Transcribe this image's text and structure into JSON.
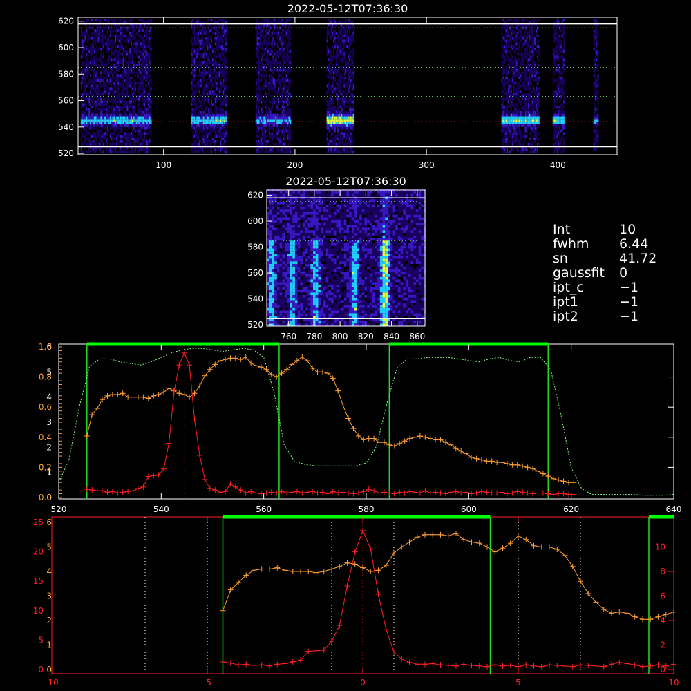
{
  "colors": {
    "background": "#000000",
    "axis_white": "#ffffff",
    "axis_red": "#ff2020",
    "orange": "#ffa030",
    "red_curve": "#ff2020",
    "green_bar": "#00ff00",
    "green_line": "#20e020",
    "green_dotted": "#80ff80",
    "image_low": "#1a0060",
    "image_mid": "#3a18c8",
    "image_high": "#20d0ff",
    "image_peak": "#e0ff40"
  },
  "info_panel": {
    "rows": [
      {
        "key": "Int",
        "value": "10"
      },
      {
        "key": "fwhm",
        "value": "6.44"
      },
      {
        "key": "sn",
        "value": "41.72"
      },
      {
        "key": "gaussfit",
        "value": "0"
      },
      {
        "key": "ipt_c",
        "value": "−1"
      },
      {
        "key": "ipt1",
        "value": "−1"
      },
      {
        "key": "ipt2",
        "value": "−1"
      }
    ]
  },
  "chart_data": [
    {
      "type": "heatmap",
      "title": "2022-05-12T07:36:30",
      "xlim": [
        35,
        445
      ],
      "ylim": [
        519,
        623
      ],
      "xticks": [
        100,
        200,
        300,
        400
      ],
      "yticks": [
        520,
        540,
        560,
        580,
        600,
        620
      ],
      "hlines_white": [
        525,
        618
      ],
      "hlines_green_dotted": [
        563,
        585,
        615
      ],
      "hline_red_dotted": 544,
      "bands": [
        {
          "x0": 37,
          "x1": 90,
          "strength": 0.55
        },
        {
          "x0": 121,
          "x1": 147,
          "strength": 0.6
        },
        {
          "x0": 170,
          "x1": 196,
          "strength": 0.45
        },
        {
          "x0": 224,
          "x1": 244,
          "strength": 1.0
        },
        {
          "x0": 357,
          "x1": 385,
          "strength": 0.75
        },
        {
          "x0": 396,
          "x1": 404,
          "strength": 0.7
        },
        {
          "x0": 427,
          "x1": 430,
          "strength": 0.5
        }
      ],
      "line_center": 544
    },
    {
      "type": "heatmap",
      "title": "2022-05-12T07:36:30",
      "xlim": [
        743,
        866
      ],
      "ylim": [
        519,
        624
      ],
      "xticks": [
        760,
        780,
        800,
        820,
        840,
        860
      ],
      "yticks": [
        520,
        540,
        560,
        580,
        600,
        620
      ],
      "hlines_white": [
        525,
        618
      ],
      "hlines_green_dotted": [
        563,
        585,
        615
      ],
      "columns_bright": [
        746,
        762,
        780,
        810,
        834
      ],
      "peak_column": 834
    },
    {
      "type": "line",
      "xlim": [
        520,
        640
      ],
      "xticks": [
        520,
        540,
        560,
        580,
        600,
        620,
        640
      ],
      "left_axis_white": {
        "ylim": [
          0,
          6
        ],
        "ticks": [
          "0",
          "1",
          "2",
          "3",
          "4",
          "5",
          "6"
        ]
      },
      "left_axis_orange": {
        "ylim": [
          0,
          1.0
        ],
        "ticks": [
          "0.0",
          "0.2",
          "0.4",
          "0.6",
          "0.8",
          "1.0"
        ]
      },
      "green_ranges": [
        [
          525.5,
          563
        ],
        [
          584.5,
          615.5
        ]
      ],
      "red_peak_x": 544.5,
      "series": [
        {
          "color": "orange",
          "x": [
            525.5,
            526.5,
            527.5,
            528.5,
            529.5,
            530.5,
            531.5,
            532.5,
            533.5,
            534.5,
            535.5,
            536.5,
            537.5,
            538.5,
            539.5,
            540.5,
            541.5,
            542.5,
            543.5,
            544.5,
            545.5,
            546.5,
            547.5,
            548.5,
            549.5,
            550.5,
            551.5,
            552.5,
            553.5,
            554.5,
            555.5,
            556.5,
            557.5,
            558.5,
            559.5,
            560.5,
            561.5,
            562.5,
            563.5,
            564.5,
            565.5,
            566.5,
            567.5,
            568.5,
            569.5,
            570.5,
            571.5,
            572.5,
            573.5,
            574.5,
            575.5,
            576.5,
            577.5,
            578.5,
            579.5,
            580.5,
            581.5,
            582.5,
            583.5,
            584.5,
            585.5,
            586.5,
            587.5,
            588.5,
            589.5,
            590.5,
            591.5,
            592.5,
            593.5,
            594.5,
            595.5,
            596.5,
            597.5,
            598.5,
            599.5,
            600.5,
            601.5,
            602.5,
            603.5,
            604.5,
            605.5,
            606.5,
            607.5,
            608.5,
            609.5,
            610.5,
            611.5,
            612.5,
            613.5,
            614.5,
            615.5,
            616.5,
            617.5,
            618.5,
            619.5,
            620.5
          ],
          "y": [
            2.45,
            3.3,
            3.55,
            3.9,
            4.05,
            4.1,
            4.1,
            4.15,
            4.0,
            4.0,
            4.0,
            4.0,
            3.95,
            4.05,
            4.1,
            4.2,
            4.35,
            4.25,
            4.15,
            4.1,
            4.0,
            4.15,
            4.45,
            4.85,
            5.1,
            5.3,
            5.45,
            5.5,
            5.55,
            5.55,
            5.5,
            5.6,
            5.35,
            5.25,
            5.2,
            5.1,
            4.9,
            4.8,
            4.95,
            5.1,
            5.3,
            5.45,
            5.6,
            5.45,
            5.15,
            5.0,
            5.0,
            4.95,
            4.75,
            4.25,
            3.65,
            3.15,
            2.75,
            2.45,
            2.3,
            2.35,
            2.35,
            2.2,
            2.2,
            2.1,
            2.05,
            2.15,
            2.25,
            2.35,
            2.4,
            2.45,
            2.4,
            2.35,
            2.3,
            2.3,
            2.2,
            2.1,
            1.95,
            1.85,
            1.75,
            1.6,
            1.55,
            1.5,
            1.45,
            1.45,
            1.4,
            1.4,
            1.35,
            1.3,
            1.3,
            1.25,
            1.2,
            1.15,
            1.05,
            0.95,
            0.85,
            0.75,
            0.7,
            0.65,
            0.6,
            0.6
          ]
        },
        {
          "color": "red",
          "x": [
            525.5,
            526.5,
            527.5,
            528.5,
            529.5,
            530.5,
            531.5,
            532.5,
            533.5,
            534.5,
            535.5,
            536.5,
            537.5,
            538.5,
            539.5,
            540.5,
            541.5,
            542.5,
            543.5,
            544.5,
            545.5,
            546.5,
            547.5,
            548.5,
            549.5,
            550.5,
            551.5,
            552.5,
            553.5,
            554.5,
            555.5,
            556.5,
            557.5,
            558.5,
            559.5,
            560.5,
            561.5,
            562.5,
            563.5,
            564.5,
            565.5,
            566.5,
            567.5,
            568.5,
            569.5,
            570.5,
            571.5,
            572.5,
            573.5,
            574.5,
            575.5,
            576.5,
            577.5,
            578.5,
            579.5,
            580.5,
            581.5,
            582.5,
            583.5,
            584.5,
            585.5,
            586.5,
            587.5,
            588.5,
            589.5,
            590.5,
            591.5,
            592.5,
            593.5,
            594.5,
            595.5,
            596.5,
            597.5,
            598.5,
            599.5,
            600.5,
            601.5,
            602.5,
            603.5,
            604.5,
            605.5,
            606.5,
            607.5,
            608.5,
            609.5,
            610.5,
            611.5,
            612.5,
            613.5,
            614.5,
            615.5,
            616.5,
            617.5,
            618.5,
            619.5,
            620.5
          ],
          "y": [
            0.055,
            0.05,
            0.045,
            0.045,
            0.035,
            0.04,
            0.03,
            0.035,
            0.04,
            0.045,
            0.06,
            0.07,
            0.14,
            0.145,
            0.15,
            0.19,
            0.36,
            0.7,
            0.88,
            0.96,
            0.88,
            0.52,
            0.28,
            0.12,
            0.06,
            0.05,
            0.035,
            0.04,
            0.09,
            0.07,
            0.05,
            0.03,
            0.04,
            0.03,
            0.025,
            0.03,
            0.035,
            0.03,
            0.04,
            0.03,
            0.035,
            0.04,
            0.03,
            0.035,
            0.04,
            0.03,
            0.035,
            0.025,
            0.04,
            0.03,
            0.035,
            0.03,
            0.025,
            0.03,
            0.04,
            0.055,
            0.045,
            0.03,
            0.035,
            0.03,
            0.025,
            0.035,
            0.03,
            0.04,
            0.035,
            0.03,
            0.045,
            0.03,
            0.035,
            0.03,
            0.025,
            0.035,
            0.04,
            0.03,
            0.035,
            0.025,
            0.03,
            0.04,
            0.035,
            0.03,
            0.03,
            0.035,
            0.025,
            0.03,
            0.04,
            0.035,
            0.03,
            0.025,
            0.03,
            0.03,
            0.025,
            0.02,
            0.025,
            0.025,
            0.02,
            0.02
          ]
        },
        {
          "color": "green-dotted",
          "x": [
            520,
            522,
            524,
            526,
            528,
            530,
            532,
            534,
            536,
            538,
            540,
            542,
            544,
            546,
            548,
            550,
            552,
            554,
            556,
            558,
            560,
            562,
            564,
            566,
            568,
            570,
            572,
            574,
            576,
            578,
            580,
            582,
            584,
            586,
            588,
            590,
            592,
            594,
            596,
            598,
            600,
            602,
            604,
            606,
            608,
            610,
            612,
            614,
            616,
            618,
            620,
            622,
            624,
            626,
            628,
            630,
            632,
            634,
            636,
            638,
            640
          ],
          "y": [
            0.1,
            0.25,
            0.6,
            0.87,
            0.92,
            0.92,
            0.9,
            0.89,
            0.88,
            0.9,
            0.93,
            0.96,
            0.98,
            0.99,
            0.99,
            0.98,
            0.97,
            0.98,
            0.99,
            0.98,
            0.93,
            0.7,
            0.35,
            0.24,
            0.22,
            0.21,
            0.21,
            0.21,
            0.21,
            0.21,
            0.23,
            0.34,
            0.62,
            0.86,
            0.92,
            0.92,
            0.93,
            0.93,
            0.93,
            0.92,
            0.91,
            0.9,
            0.92,
            0.93,
            0.91,
            0.9,
            0.93,
            0.93,
            0.85,
            0.55,
            0.2,
            0.06,
            0.02,
            0.02,
            0.02,
            0.02,
            0.02,
            0.015,
            0.015,
            0.015,
            0.02
          ]
        }
      ]
    },
    {
      "type": "line",
      "xlim": [
        -10,
        10
      ],
      "xticks": [
        -10,
        -5,
        0,
        5,
        10
      ],
      "left_axis_red": {
        "ylim": [
          0,
          25
        ],
        "ticks": [
          "0",
          "5",
          "10",
          "15",
          "20",
          "25"
        ]
      },
      "left_axis_orange": {
        "ylim": [
          0,
          6
        ],
        "ticks": [
          "0",
          "1",
          "2",
          "3",
          "4",
          "5",
          "6"
        ]
      },
      "right_axis_red": {
        "ylim": [
          0,
          12
        ],
        "ticks": [
          "0",
          "2",
          "4",
          "6",
          "8",
          "10"
        ]
      },
      "green_ranges": [
        [
          -4.5,
          4.1
        ],
        [
          9.2,
          12
        ]
      ],
      "white_dotted_x": [
        -7,
        -5,
        -1,
        1,
        5,
        7
      ],
      "red_dotted_x": [
        0
      ],
      "series": [
        {
          "color": "orange",
          "x": [
            -4.5,
            -4.25,
            -4.0,
            -3.75,
            -3.5,
            -3.25,
            -3.0,
            -2.75,
            -2.5,
            -2.25,
            -2.0,
            -1.75,
            -1.5,
            -1.25,
            -1.0,
            -0.75,
            -0.5,
            -0.25,
            0.0,
            0.25,
            0.5,
            0.75,
            1.0,
            1.25,
            1.5,
            1.75,
            2.0,
            2.25,
            2.5,
            2.75,
            3.0,
            3.25,
            3.5,
            3.75,
            4.0,
            4.25,
            4.5,
            4.75,
            5.0,
            5.25,
            5.5,
            5.75,
            6.0,
            6.25,
            6.5,
            6.75,
            7.0,
            7.25,
            7.5,
            7.75,
            8.0,
            8.25,
            8.5,
            8.75,
            9.0,
            9.25,
            9.5,
            9.75,
            10.0
          ],
          "y": [
            2.4,
            3.25,
            3.55,
            3.85,
            4.05,
            4.1,
            4.1,
            4.15,
            4.05,
            4.0,
            4.0,
            4.0,
            3.95,
            4.0,
            4.1,
            4.2,
            4.35,
            4.3,
            4.15,
            4.0,
            4.05,
            4.25,
            4.75,
            5.0,
            5.2,
            5.4,
            5.5,
            5.5,
            5.5,
            5.45,
            5.55,
            5.3,
            5.2,
            5.15,
            5.0,
            4.8,
            4.95,
            5.15,
            5.45,
            5.3,
            5.05,
            5.0,
            5.0,
            4.9,
            4.65,
            4.2,
            3.6,
            3.1,
            2.75,
            2.45,
            2.3,
            2.35,
            2.3,
            2.15,
            2.05,
            2.05,
            2.15,
            2.25,
            2.35
          ]
        },
        {
          "color": "red",
          "x": [
            -4.5,
            -4.25,
            -4.0,
            -3.75,
            -3.5,
            -3.25,
            -3.0,
            -2.75,
            -2.5,
            -2.25,
            -2.0,
            -1.75,
            -1.5,
            -1.25,
            -1.0,
            -0.75,
            -0.5,
            -0.25,
            0.0,
            0.25,
            0.5,
            0.75,
            1.0,
            1.25,
            1.5,
            1.75,
            2.0,
            2.25,
            2.5,
            2.75,
            3.0,
            3.25,
            3.5,
            3.75,
            4.0,
            4.25,
            4.5,
            4.75,
            5.0,
            5.25,
            5.5,
            5.75,
            6.0,
            6.25,
            6.5,
            6.75,
            7.0,
            7.25,
            7.5,
            7.75,
            8.0,
            8.25,
            8.5,
            8.75,
            9.0,
            9.25,
            9.5,
            9.75,
            10.0
          ],
          "y": [
            1.3,
            1.1,
            0.8,
            0.9,
            0.7,
            0.8,
            0.6,
            0.9,
            1.0,
            1.3,
            1.6,
            3.1,
            3.2,
            3.3,
            4.8,
            7.5,
            14.2,
            20.0,
            23.6,
            20.5,
            12.8,
            6.8,
            3.0,
            1.8,
            1.2,
            0.9,
            0.9,
            1.0,
            0.8,
            0.7,
            0.6,
            0.9,
            0.7,
            0.6,
            0.5,
            0.8,
            0.6,
            0.7,
            0.5,
            0.8,
            0.6,
            0.5,
            0.8,
            0.7,
            0.6,
            0.5,
            0.8,
            0.7,
            0.6,
            0.5,
            0.9,
            1.2,
            1.0,
            0.8,
            0.5,
            0.6,
            0.8,
            0.6,
            0.9
          ]
        }
      ]
    }
  ]
}
